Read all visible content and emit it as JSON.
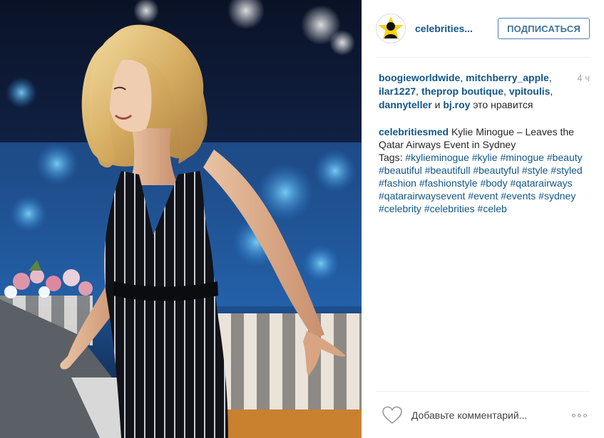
{
  "header": {
    "username": "celebrities...",
    "follow_label": "ПОДПИСАТЬСЯ"
  },
  "likes": {
    "users": [
      "boogieworldwide",
      "mitchberry_apple",
      "ilar1227",
      "theprop boutique",
      "vpitoulis",
      "dannyteller",
      "bj.roy"
    ],
    "and_word": "и",
    "suffix": "это нравится",
    "time_ago": "4 ч"
  },
  "caption": {
    "author": "celebritiesmed",
    "text": "Kylie Minogue – Leaves the Qatar Airways Event in Sydney",
    "tags_label": "Tags:",
    "tags": [
      "#kylieminogue",
      "#kylie",
      "#minogue",
      "#beauty",
      "#beautiful",
      "#beautifull",
      "#beautyful",
      "#style",
      "#styled",
      "#fashion",
      "#fashionstyle",
      "#body",
      "#qatarairways",
      "#qatarairwaysevent",
      "#event",
      "#events",
      "#sydney",
      "#celebrity",
      "#celebrities",
      "#celeb"
    ]
  },
  "comment": {
    "placeholder": "Добавьте комментарий..."
  },
  "icons": {
    "avatar": "star-silhouette-avatar",
    "like": "heart-icon",
    "more": "more-options-icon"
  },
  "colors": {
    "link": "#125688",
    "follow_border": "#4e7fb3",
    "avatar_star": "#f6d21b"
  }
}
